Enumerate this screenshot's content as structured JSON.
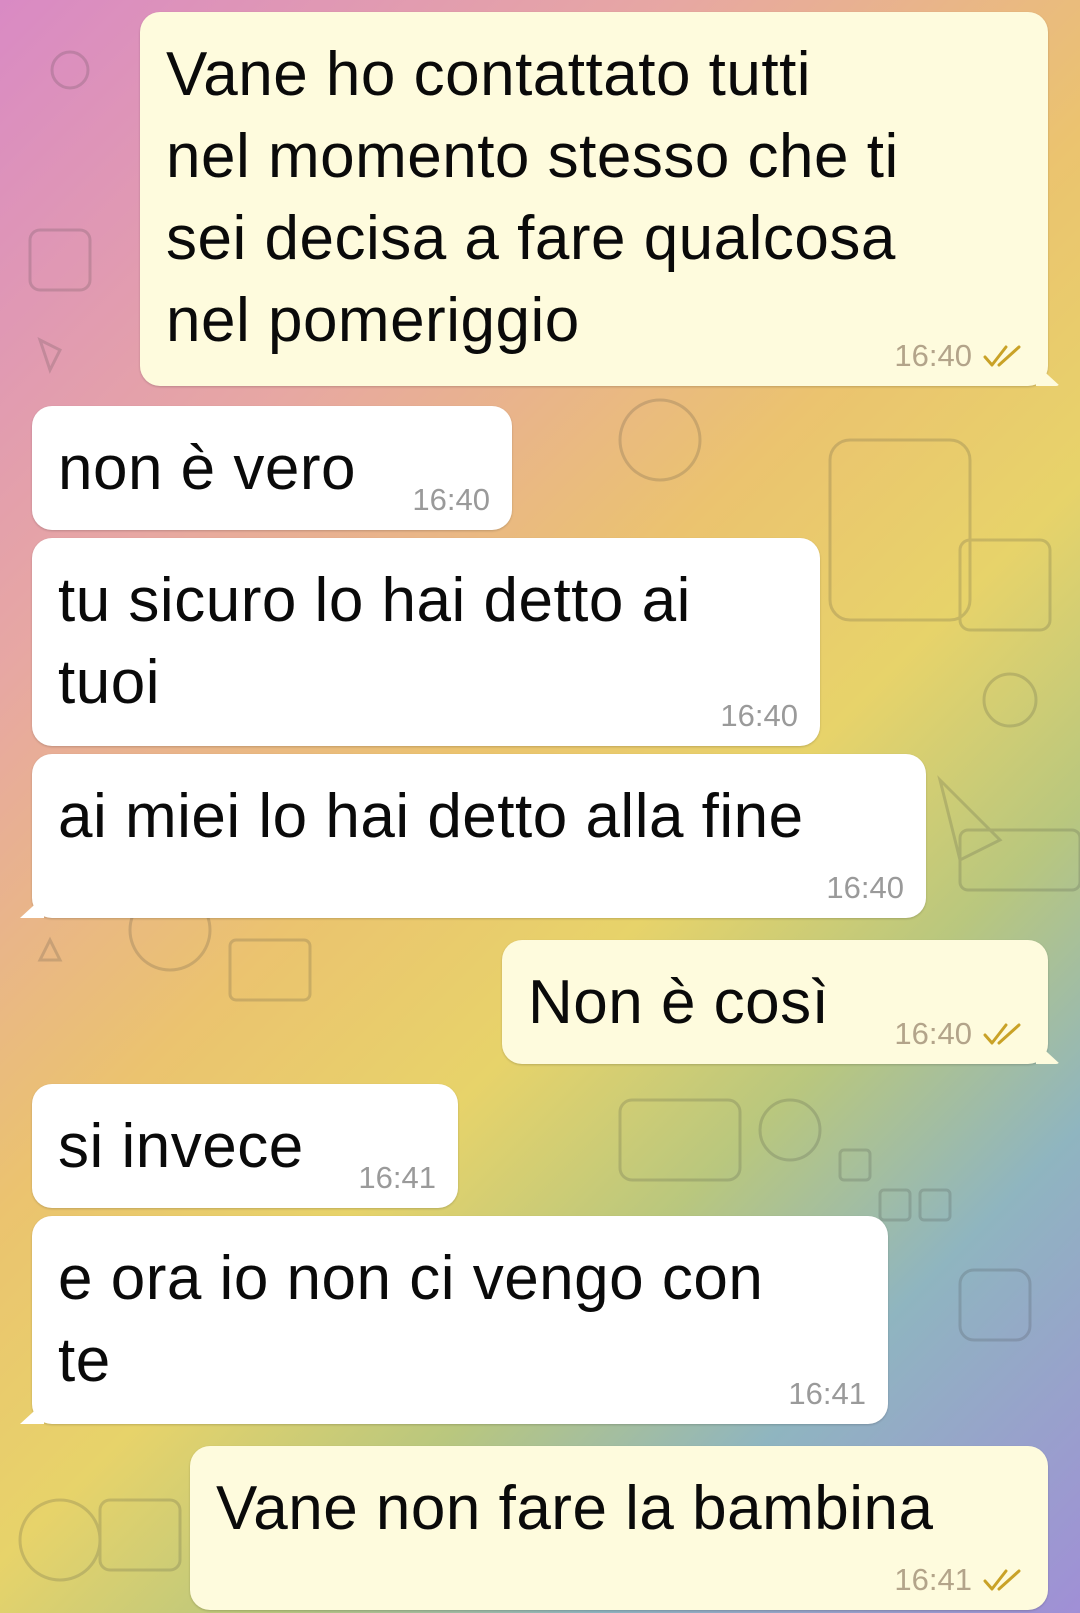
{
  "theme": {
    "outgoing_bubble": "#fefbdd",
    "incoming_bubble": "#ffffff",
    "tick_color": "#c9a227"
  },
  "messages": [
    {
      "direction": "out",
      "text": "Vane ho contattato tutti\nnel momento stesso che ti\nsei decisa a fare qualcosa\nnel pomeriggio",
      "time": "16:40",
      "read": true
    },
    {
      "direction": "in",
      "text": "non è vero",
      "time": "16:40"
    },
    {
      "direction": "in",
      "text": "tu sicuro lo hai detto ai\ntuoi",
      "time": "16:40"
    },
    {
      "direction": "in",
      "text": "ai miei lo hai detto alla fine",
      "time": "16:40"
    },
    {
      "direction": "out",
      "text": "Non è così",
      "time": "16:40",
      "read": true
    },
    {
      "direction": "in",
      "text": "si invece",
      "time": "16:41"
    },
    {
      "direction": "in",
      "text": "e ora io non ci vengo con\nte",
      "time": "16:41"
    },
    {
      "direction": "out",
      "text": "Vane non fare la bambina",
      "time": "16:41",
      "read": true
    }
  ]
}
